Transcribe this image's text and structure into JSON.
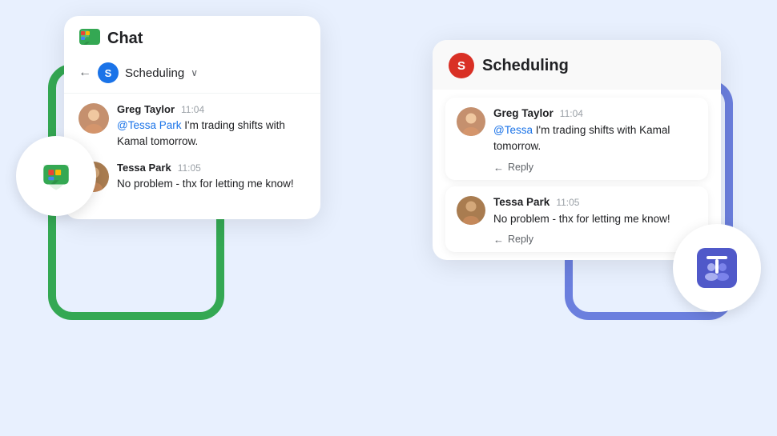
{
  "background": {
    "color": "#e8f0fe"
  },
  "left_card": {
    "app_name": "Chat",
    "subheader": {
      "channel": "Scheduling"
    },
    "messages": [
      {
        "sender": "Greg Taylor",
        "time": "11:04",
        "text_before_mention": "",
        "mention": "@Tessa Park",
        "text_after_mention": " I'm trading shifts with Kamal tomorrow.",
        "avatar_color": "#c5906e"
      },
      {
        "sender": "Tessa Park",
        "time": "11:05",
        "text": "No problem - thx for letting me know!",
        "avatar_color": "#a97c50"
      }
    ]
  },
  "right_card": {
    "channel_letter": "S",
    "channel_name": "Scheduling",
    "messages": [
      {
        "sender": "Greg Taylor",
        "time": "11:04",
        "mention": "@Tessa",
        "text": " I'm trading shifts with Kamal tomorrow.",
        "reply_label": "Reply",
        "avatar_color": "#c5906e"
      },
      {
        "sender": "Tessa Park",
        "time": "11:05",
        "text": "No problem - thx for letting me know!",
        "reply_label": "Reply",
        "avatar_color": "#a97c50"
      }
    ]
  }
}
